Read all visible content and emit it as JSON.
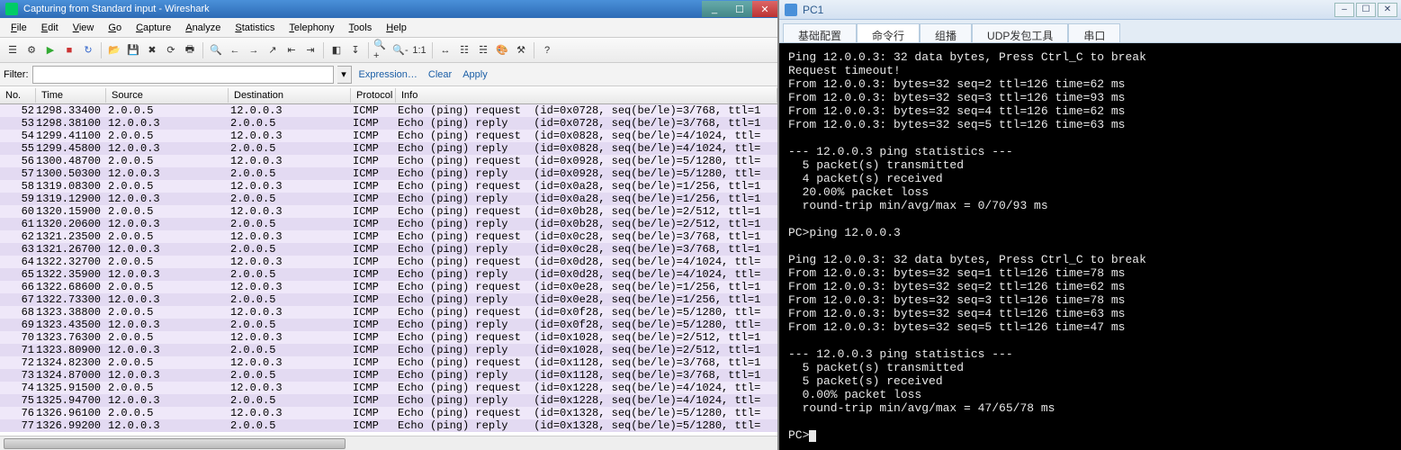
{
  "wireshark": {
    "title": "Capturing from Standard input - Wireshark",
    "menu": [
      "File",
      "Edit",
      "View",
      "Go",
      "Capture",
      "Analyze",
      "Statistics",
      "Telephony",
      "Tools",
      "Help"
    ],
    "filter_label": "Filter:",
    "filter_value": "",
    "filter_links": [
      "Expression…",
      "Clear",
      "Apply"
    ],
    "columns": [
      "No.",
      "Time",
      "Source",
      "Destination",
      "Protocol",
      "Info"
    ],
    "rows": [
      {
        "no": "52",
        "time": "1298.33400",
        "src": "2.0.0.5",
        "dst": "12.0.0.3",
        "proto": "ICMP",
        "info": "Echo (ping) request  (id=0x0728, seq(be/le)=3/768, ttl=1",
        "type": "request"
      },
      {
        "no": "53",
        "time": "1298.38100",
        "src": "12.0.0.3",
        "dst": "2.0.0.5",
        "proto": "ICMP",
        "info": "Echo (ping) reply    (id=0x0728, seq(be/le)=3/768, ttl=1",
        "type": "reply"
      },
      {
        "no": "54",
        "time": "1299.41100",
        "src": "2.0.0.5",
        "dst": "12.0.0.3",
        "proto": "ICMP",
        "info": "Echo (ping) request  (id=0x0828, seq(be/le)=4/1024, ttl=",
        "type": "request"
      },
      {
        "no": "55",
        "time": "1299.45800",
        "src": "12.0.0.3",
        "dst": "2.0.0.5",
        "proto": "ICMP",
        "info": "Echo (ping) reply    (id=0x0828, seq(be/le)=4/1024, ttl=",
        "type": "reply"
      },
      {
        "no": "56",
        "time": "1300.48700",
        "src": "2.0.0.5",
        "dst": "12.0.0.3",
        "proto": "ICMP",
        "info": "Echo (ping) request  (id=0x0928, seq(be/le)=5/1280, ttl=",
        "type": "request"
      },
      {
        "no": "57",
        "time": "1300.50300",
        "src": "12.0.0.3",
        "dst": "2.0.0.5",
        "proto": "ICMP",
        "info": "Echo (ping) reply    (id=0x0928, seq(be/le)=5/1280, ttl=",
        "type": "reply"
      },
      {
        "no": "58",
        "time": "1319.08300",
        "src": "2.0.0.5",
        "dst": "12.0.0.3",
        "proto": "ICMP",
        "info": "Echo (ping) request  (id=0x0a28, seq(be/le)=1/256, ttl=1",
        "type": "request"
      },
      {
        "no": "59",
        "time": "1319.12900",
        "src": "12.0.0.3",
        "dst": "2.0.0.5",
        "proto": "ICMP",
        "info": "Echo (ping) reply    (id=0x0a28, seq(be/le)=1/256, ttl=1",
        "type": "reply"
      },
      {
        "no": "60",
        "time": "1320.15900",
        "src": "2.0.0.5",
        "dst": "12.0.0.3",
        "proto": "ICMP",
        "info": "Echo (ping) request  (id=0x0b28, seq(be/le)=2/512, ttl=1",
        "type": "request"
      },
      {
        "no": "61",
        "time": "1320.20600",
        "src": "12.0.0.3",
        "dst": "2.0.0.5",
        "proto": "ICMP",
        "info": "Echo (ping) reply    (id=0x0b28, seq(be/le)=2/512, ttl=1",
        "type": "reply"
      },
      {
        "no": "62",
        "time": "1321.23500",
        "src": "2.0.0.5",
        "dst": "12.0.0.3",
        "proto": "ICMP",
        "info": "Echo (ping) request  (id=0x0c28, seq(be/le)=3/768, ttl=1",
        "type": "request"
      },
      {
        "no": "63",
        "time": "1321.26700",
        "src": "12.0.0.3",
        "dst": "2.0.0.5",
        "proto": "ICMP",
        "info": "Echo (ping) reply    (id=0x0c28, seq(be/le)=3/768, ttl=1",
        "type": "reply"
      },
      {
        "no": "64",
        "time": "1322.32700",
        "src": "2.0.0.5",
        "dst": "12.0.0.3",
        "proto": "ICMP",
        "info": "Echo (ping) request  (id=0x0d28, seq(be/le)=4/1024, ttl=",
        "type": "request"
      },
      {
        "no": "65",
        "time": "1322.35900",
        "src": "12.0.0.3",
        "dst": "2.0.0.5",
        "proto": "ICMP",
        "info": "Echo (ping) reply    (id=0x0d28, seq(be/le)=4/1024, ttl=",
        "type": "reply"
      },
      {
        "no": "66",
        "time": "1322.68600",
        "src": "2.0.0.5",
        "dst": "12.0.0.3",
        "proto": "ICMP",
        "info": "Echo (ping) request  (id=0x0e28, seq(be/le)=1/256, ttl=1",
        "type": "request"
      },
      {
        "no": "67",
        "time": "1322.73300",
        "src": "12.0.0.3",
        "dst": "2.0.0.5",
        "proto": "ICMP",
        "info": "Echo (ping) reply    (id=0x0e28, seq(be/le)=1/256, ttl=1",
        "type": "reply"
      },
      {
        "no": "68",
        "time": "1323.38800",
        "src": "2.0.0.5",
        "dst": "12.0.0.3",
        "proto": "ICMP",
        "info": "Echo (ping) request  (id=0x0f28, seq(be/le)=5/1280, ttl=",
        "type": "request"
      },
      {
        "no": "69",
        "time": "1323.43500",
        "src": "12.0.0.3",
        "dst": "2.0.0.5",
        "proto": "ICMP",
        "info": "Echo (ping) reply    (id=0x0f28, seq(be/le)=5/1280, ttl=",
        "type": "reply"
      },
      {
        "no": "70",
        "time": "1323.76300",
        "src": "2.0.0.5",
        "dst": "12.0.0.3",
        "proto": "ICMP",
        "info": "Echo (ping) request  (id=0x1028, seq(be/le)=2/512, ttl=1",
        "type": "request"
      },
      {
        "no": "71",
        "time": "1323.80900",
        "src": "12.0.0.3",
        "dst": "2.0.0.5",
        "proto": "ICMP",
        "info": "Echo (ping) reply    (id=0x1028, seq(be/le)=2/512, ttl=1",
        "type": "reply"
      },
      {
        "no": "72",
        "time": "1324.82300",
        "src": "2.0.0.5",
        "dst": "12.0.0.3",
        "proto": "ICMP",
        "info": "Echo (ping) request  (id=0x1128, seq(be/le)=3/768, ttl=1",
        "type": "request"
      },
      {
        "no": "73",
        "time": "1324.87000",
        "src": "12.0.0.3",
        "dst": "2.0.0.5",
        "proto": "ICMP",
        "info": "Echo (ping) reply    (id=0x1128, seq(be/le)=3/768, ttl=1",
        "type": "reply"
      },
      {
        "no": "74",
        "time": "1325.91500",
        "src": "2.0.0.5",
        "dst": "12.0.0.3",
        "proto": "ICMP",
        "info": "Echo (ping) request  (id=0x1228, seq(be/le)=4/1024, ttl=",
        "type": "request"
      },
      {
        "no": "75",
        "time": "1325.94700",
        "src": "12.0.0.3",
        "dst": "2.0.0.5",
        "proto": "ICMP",
        "info": "Echo (ping) reply    (id=0x1228, seq(be/le)=4/1024, ttl=",
        "type": "reply"
      },
      {
        "no": "76",
        "time": "1326.96100",
        "src": "2.0.0.5",
        "dst": "12.0.0.3",
        "proto": "ICMP",
        "info": "Echo (ping) request  (id=0x1328, seq(be/le)=5/1280, ttl=",
        "type": "request"
      },
      {
        "no": "77",
        "time": "1326.99200",
        "src": "12.0.0.3",
        "dst": "2.0.0.5",
        "proto": "ICMP",
        "info": "Echo (ping) reply    (id=0x1328, seq(be/le)=5/1280, ttl=",
        "type": "reply"
      }
    ]
  },
  "pc1": {
    "title": "PC1",
    "tabs": [
      "基础配置",
      "命令行",
      "组播",
      "UDP发包工具",
      "串口"
    ],
    "active_tab": 1,
    "terminal_lines": [
      "Ping 12.0.0.3: 32 data bytes, Press Ctrl_C to break",
      "Request timeout!",
      "From 12.0.0.3: bytes=32 seq=2 ttl=126 time=62 ms",
      "From 12.0.0.3: bytes=32 seq=3 ttl=126 time=93 ms",
      "From 12.0.0.3: bytes=32 seq=4 ttl=126 time=62 ms",
      "From 12.0.0.3: bytes=32 seq=5 ttl=126 time=63 ms",
      "",
      "--- 12.0.0.3 ping statistics ---",
      "  5 packet(s) transmitted",
      "  4 packet(s) received",
      "  20.00% packet loss",
      "  round-trip min/avg/max = 0/70/93 ms",
      "",
      "PC>ping 12.0.0.3",
      "",
      "Ping 12.0.0.3: 32 data bytes, Press Ctrl_C to break",
      "From 12.0.0.3: bytes=32 seq=1 ttl=126 time=78 ms",
      "From 12.0.0.3: bytes=32 seq=2 ttl=126 time=62 ms",
      "From 12.0.0.3: bytes=32 seq=3 ttl=126 time=78 ms",
      "From 12.0.0.3: bytes=32 seq=4 ttl=126 time=63 ms",
      "From 12.0.0.3: bytes=32 seq=5 ttl=126 time=47 ms",
      "",
      "--- 12.0.0.3 ping statistics ---",
      "  5 packet(s) transmitted",
      "  5 packet(s) received",
      "  0.00% packet loss",
      "  round-trip min/avg/max = 47/65/78 ms",
      "",
      "PC>"
    ]
  }
}
